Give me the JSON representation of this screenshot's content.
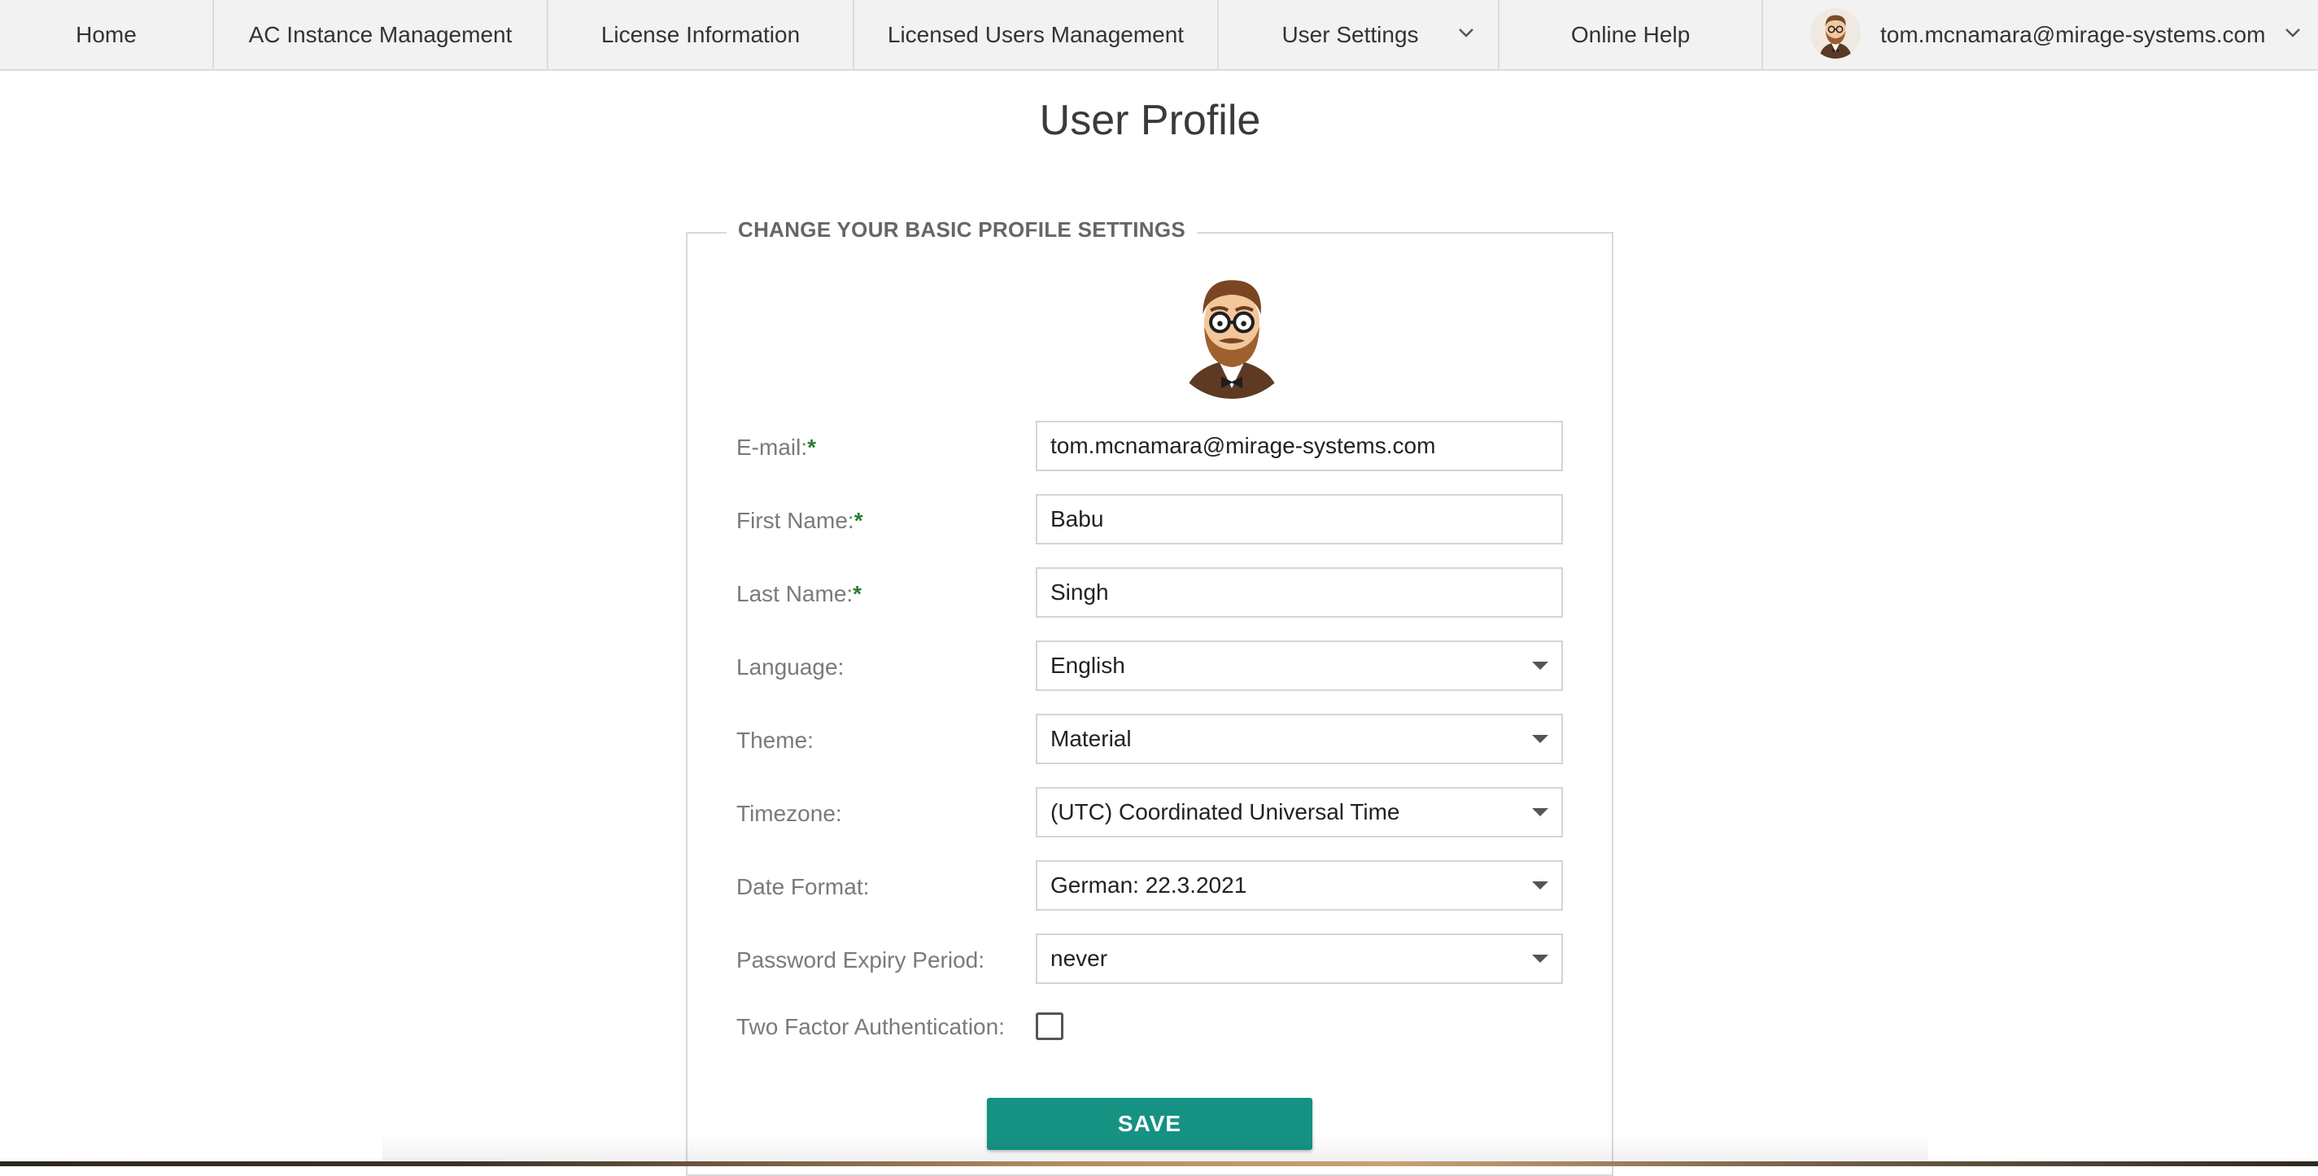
{
  "nav": {
    "items": [
      {
        "label": "Home"
      },
      {
        "label": "AC Instance Management"
      },
      {
        "label": "License Information"
      },
      {
        "label": "Licensed Users Management"
      },
      {
        "label": "User Settings"
      },
      {
        "label": "Online Help"
      }
    ],
    "user_email": "tom.mcnamara@mirage-systems.com"
  },
  "page": {
    "title": "User Profile"
  },
  "form": {
    "legend": "CHANGE YOUR BASIC PROFILE SETTINGS",
    "required_mark": "*",
    "email": {
      "label": "E-mail:",
      "value": "tom.mcnamara@mirage-systems.com"
    },
    "first_name": {
      "label": "First Name:",
      "value": "Babu"
    },
    "last_name": {
      "label": "Last Name:",
      "value": "Singh"
    },
    "language": {
      "label": "Language:",
      "value": "English"
    },
    "theme": {
      "label": "Theme:",
      "value": "Material"
    },
    "timezone": {
      "label": "Timezone:",
      "value": "(UTC) Coordinated Universal Time"
    },
    "date_format": {
      "label": "Date Format:",
      "value": "German: 22.3.2021"
    },
    "password_expiry": {
      "label": "Password Expiry Period:",
      "value": "never"
    },
    "two_factor": {
      "label": "Two Factor Authentication:",
      "checked": false
    },
    "save_label": "SAVE"
  },
  "colors": {
    "accent": "#169282",
    "required": "#2e7d32",
    "nav_bg": "#f2f2f2"
  },
  "icons": {
    "nav_dropdown": "chevron-down-icon",
    "select_caret": "caret-down-icon",
    "avatar": "avatar"
  }
}
